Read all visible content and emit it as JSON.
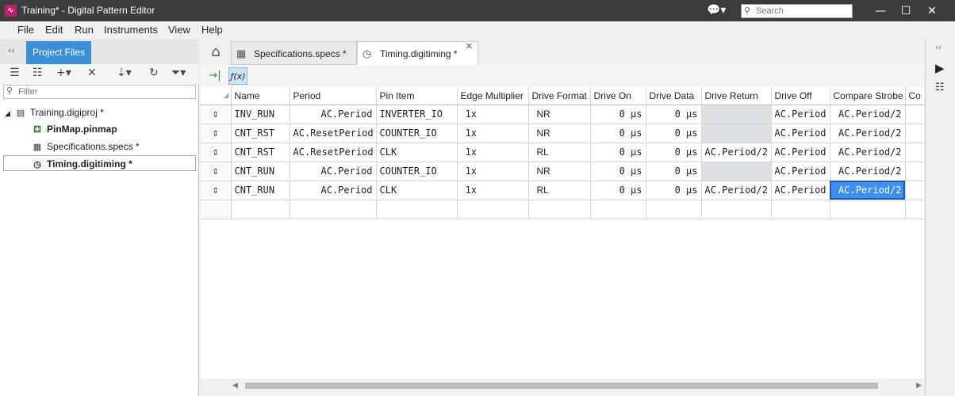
{
  "window": {
    "title": "Training* - Digital Pattern Editor",
    "app_icon": "digital-pattern-icon",
    "search_placeholder": "Search"
  },
  "menu": [
    "File",
    "Edit",
    "Run",
    "Instruments",
    "View",
    "Help"
  ],
  "project_panel": {
    "tab_label": "Project Files",
    "filter_placeholder": "Filter",
    "tree": [
      {
        "label": "Training.digiproj *",
        "icon": "project-icon"
      },
      {
        "label": "PinMap.pinmap",
        "icon": "pinmap-icon"
      },
      {
        "label": "Specifications.specs *",
        "icon": "specs-icon"
      },
      {
        "label": "Timing.digitiming *",
        "icon": "timing-icon"
      }
    ]
  },
  "doc_tabs": [
    {
      "label": "Specifications.specs *",
      "icon": "specs-icon"
    },
    {
      "label": "Timing.digitiming *",
      "icon": "clock-icon",
      "active": true
    }
  ],
  "grid": {
    "columns": [
      "Name",
      "Period",
      "Pin Item",
      "Edge Multiplier",
      "Drive Format",
      "Drive On",
      "Drive Data",
      "Drive Return",
      "Drive Off",
      "Compare Strobe",
      "Co"
    ],
    "rows": [
      [
        "INV_RUN",
        "AC.Period",
        "INVERTER_IO",
        "1x",
        "NR",
        "0 µs",
        "0 µs",
        "",
        "AC.Period",
        "AC.Period/2"
      ],
      [
        "CNT_RST",
        "AC.ResetPeriod",
        "COUNTER_IO",
        "1x",
        "NR",
        "0 µs",
        "0 µs",
        "",
        "AC.Period",
        "AC.Period/2"
      ],
      [
        "CNT_RST",
        "AC.ResetPeriod",
        "CLK",
        "1x",
        "RL",
        "0 µs",
        "0 µs",
        "AC.Period/2",
        "AC.Period",
        "AC.Period/2"
      ],
      [
        "CNT_RUN",
        "AC.Period",
        "COUNTER_IO",
        "1x",
        "NR",
        "0 µs",
        "0 µs",
        "",
        "AC.Period",
        "AC.Period/2"
      ],
      [
        "CNT_RUN",
        "AC.Period",
        "CLK",
        "1x",
        "RL",
        "0 µs",
        "0 µs",
        "AC.Period/2",
        "AC.Period",
        "AC.Period/2"
      ]
    ],
    "selected_cell": {
      "row": 4,
      "column": "Compare Strobe"
    }
  },
  "colors": {
    "accent": "#3b8fd6",
    "titlebar": "#3c3c3c",
    "selection": "#3e8ff2",
    "disabled_cell": "#dde0e2"
  }
}
